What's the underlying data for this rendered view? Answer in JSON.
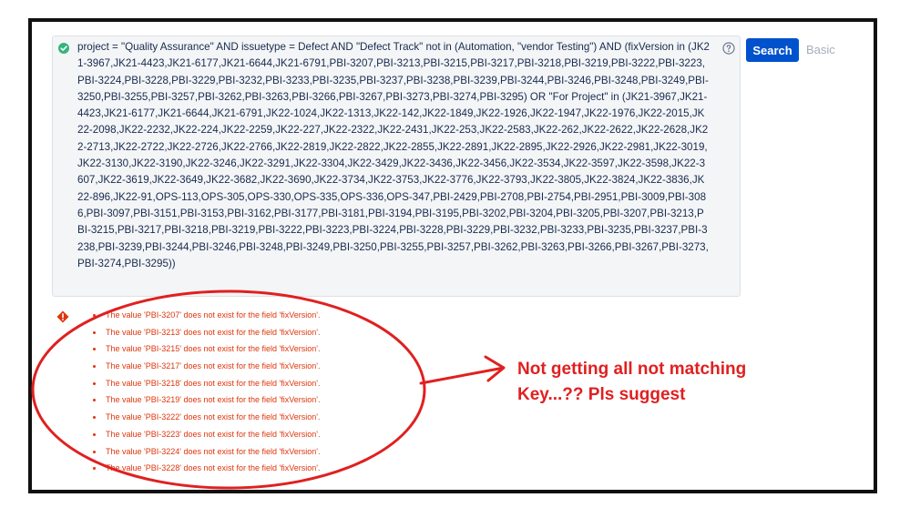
{
  "query_editor": {
    "text": "project = \"Quality Assurance\" AND issuetype = Defect AND \"Defect Track\" not in (Automation, \"vendor Testing\") AND (fixVersion in (JK21-3967,JK21-4423,JK21-6177,JK21-6644,JK21-6791,PBI-3207,PBI-3213,PBI-3215,PBI-3217,PBI-3218,PBI-3219,PBI-3222,PBI-3223,PBI-3224,PBI-3228,PBI-3229,PBI-3232,PBI-3233,PBI-3235,PBI-3237,PBI-3238,PBI-3239,PBI-3244,PBI-3246,PBI-3248,PBI-3249,PBI-3250,PBI-3255,PBI-3257,PBI-3262,PBI-3263,PBI-3266,PBI-3267,PBI-3273,PBI-3274,PBI-3295) OR \"For Project\" in (JK21-3967,JK21-4423,JK21-6177,JK21-6644,JK21-6791,JK22-1024,JK22-1313,JK22-142,JK22-1849,JK22-1926,JK22-1947,JK22-1976,JK22-2015,JK22-2098,JK22-2232,JK22-224,JK22-2259,JK22-227,JK22-2322,JK22-2431,JK22-253,JK22-2583,JK22-262,JK22-2622,JK22-2628,JK22-2713,JK22-2722,JK22-2726,JK22-2766,JK22-2819,JK22-2822,JK22-2855,JK22-2891,JK22-2895,JK22-2926,JK22-2981,JK22-3019,JK22-3130,JK22-3190,JK22-3246,JK22-3291,JK22-3304,JK22-3429,JK22-3436,JK22-3456,JK22-3534,JK22-3597,JK22-3598,JK22-3607,JK22-3619,JK22-3649,JK22-3682,JK22-3690,JK22-3734,JK22-3753,JK22-3776,JK22-3793,JK22-3805,JK22-3824,JK22-3836,JK22-896,JK22-91,OPS-113,OPS-305,OPS-330,OPS-335,OPS-336,OPS-347,PBI-2429,PBI-2708,PBI-2754,PBI-2951,PBI-3009,PBI-3086,PBI-3097,PBI-3151,PBI-3153,PBI-3162,PBI-3177,PBI-3181,PBI-3194,PBI-3195,PBI-3202,PBI-3204,PBI-3205,PBI-3207,PBI-3213,PBI-3215,PBI-3217,PBI-3218,PBI-3219,PBI-3222,PBI-3223,PBI-3224,PBI-3228,PBI-3229,PBI-3232,PBI-3233,PBI-3235,PBI-3237,PBI-3238,PBI-3239,PBI-3244,PBI-3246,PBI-3248,PBI-3249,PBI-3250,PBI-3255,PBI-3257,PBI-3262,PBI-3263,PBI-3266,PBI-3267,PBI-3273,PBI-3274,PBI-3295))",
    "status_icon": "check-circle-icon",
    "help_icon": "question-circle-icon"
  },
  "actions": {
    "search_label": "Search",
    "basic_label": "Basic"
  },
  "errors": {
    "icon": "error-diamond-icon",
    "items": [
      "The value 'PBI-3207' does not exist for the field 'fixVersion'.",
      "The value 'PBI-3213' does not exist for the field 'fixVersion'.",
      "The value 'PBI-3215' does not exist for the field 'fixVersion'.",
      "The value 'PBI-3217' does not exist for the field 'fixVersion'.",
      "The value 'PBI-3218' does not exist for the field 'fixVersion'.",
      "The value 'PBI-3219' does not exist for the field 'fixVersion'.",
      "The value 'PBI-3222' does not exist for the field 'fixVersion'.",
      "The value 'PBI-3223' does not exist for the field 'fixVersion'.",
      "The value 'PBI-3224' does not exist for the field 'fixVersion'.",
      "The value 'PBI-3228' does not exist for the field 'fixVersion'."
    ]
  },
  "annotation": {
    "text": "Not getting all not matching Key...?? Pls suggest",
    "color": "#e02020"
  },
  "colors": {
    "primary": "#0052cc",
    "success": "#36b37e",
    "error": "#de350b",
    "frame": "#111111"
  }
}
